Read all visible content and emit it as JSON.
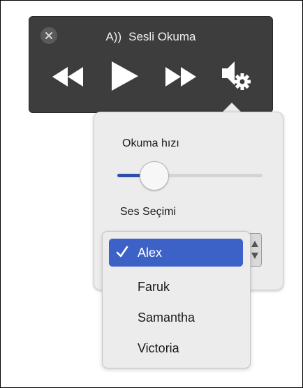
{
  "player": {
    "title_prefix": "A))",
    "title": "Sesli Okuma",
    "controls": [
      "close-icon",
      "rewind-icon",
      "play-icon",
      "fast-forward-icon",
      "speaker-gear-icon"
    ]
  },
  "settings": {
    "speed_label": "Okuma hızı",
    "speed_fraction": 0.25,
    "voice_label": "Ses Seçimi"
  },
  "voice_menu": {
    "items": [
      {
        "label": "Alex",
        "selected": true
      },
      {
        "label": "Faruk",
        "selected": false
      },
      {
        "label": "Samantha",
        "selected": false
      },
      {
        "label": "Victoria",
        "selected": false
      }
    ]
  },
  "colors": {
    "player_bg": "#3d3d3d",
    "selected_bg": "#3d62c7",
    "slider_fill": "#2d4fa8"
  }
}
